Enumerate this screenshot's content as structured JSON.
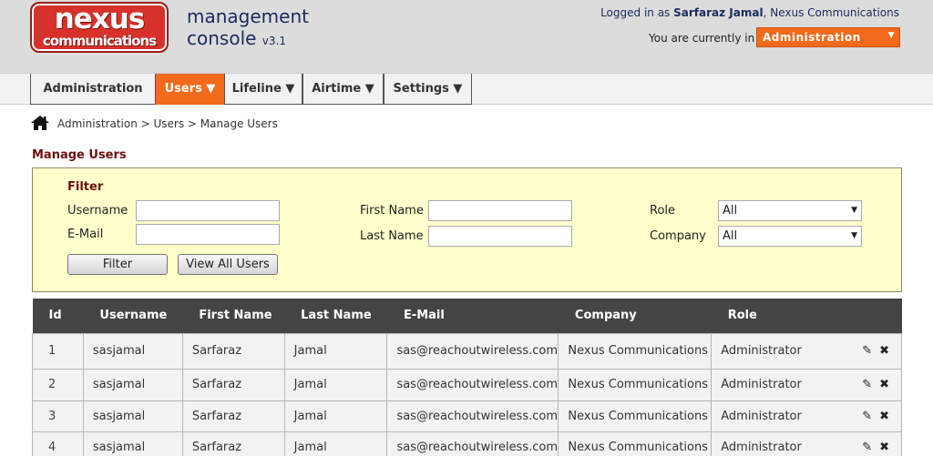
{
  "header": {
    "logo_top": "nexus",
    "logo_bottom": "communications",
    "console_line1": "management",
    "console_line2": "console",
    "version": "v3.1",
    "logged_in_prefix": "Logged in as",
    "user_name": "Sarfaraz Jamal",
    "company": "Nexus Communications",
    "current_label": "You are currently in",
    "current_value": "Administration"
  },
  "nav": [
    {
      "label": "Administration"
    },
    {
      "label": "Users ▼"
    },
    {
      "label": "Lifeline ▼"
    },
    {
      "label": "Airtime ▼"
    },
    {
      "label": "Settings ▼"
    }
  ],
  "breadcrumb": "Administration > Users > Manage Users",
  "page_title": "Manage Users",
  "filter": {
    "title": "Filter",
    "username_label": "Username",
    "email_label": "E-Mail",
    "first_name_label": "First Name",
    "last_name_label": "Last Name",
    "role_label": "Role",
    "company_label": "Company",
    "role_value": "All",
    "company_value": "All",
    "filter_button": "Filter",
    "view_all_button": "View All Users"
  },
  "table": {
    "headers": [
      "Id",
      "Username",
      "First Name",
      "Last Name",
      "E-Mail",
      "Company",
      "Role"
    ],
    "rows": [
      [
        "1",
        "sasjamal",
        "Sarfaraz",
        "Jamal",
        "sas@reachoutwireless.com",
        "Nexus Communications",
        "Administrator"
      ],
      [
        "2",
        "sasjamal",
        "Sarfaraz",
        "Jamal",
        "sas@reachoutwireless.com",
        "Nexus Communications",
        "Administrator"
      ],
      [
        "3",
        "sasjamal",
        "Sarfaraz",
        "Jamal",
        "sas@reachoutwireless.com",
        "Nexus Communications",
        "Administrator"
      ],
      [
        "4",
        "sasjamal",
        "Sarfaraz",
        "Jamal",
        "sas@reachoutwireless.com",
        "Nexus Communications",
        "Administrator"
      ]
    ]
  },
  "icons": {
    "edit": "edit-icon",
    "delete": "delete-icon",
    "home": "home-icon"
  },
  "colors": {
    "accent": "#f26a1b",
    "brand_red": "#d6322b",
    "title_dark_red": "#6b1010",
    "filter_bg": "#ffffcc",
    "table_header": "#444444"
  }
}
